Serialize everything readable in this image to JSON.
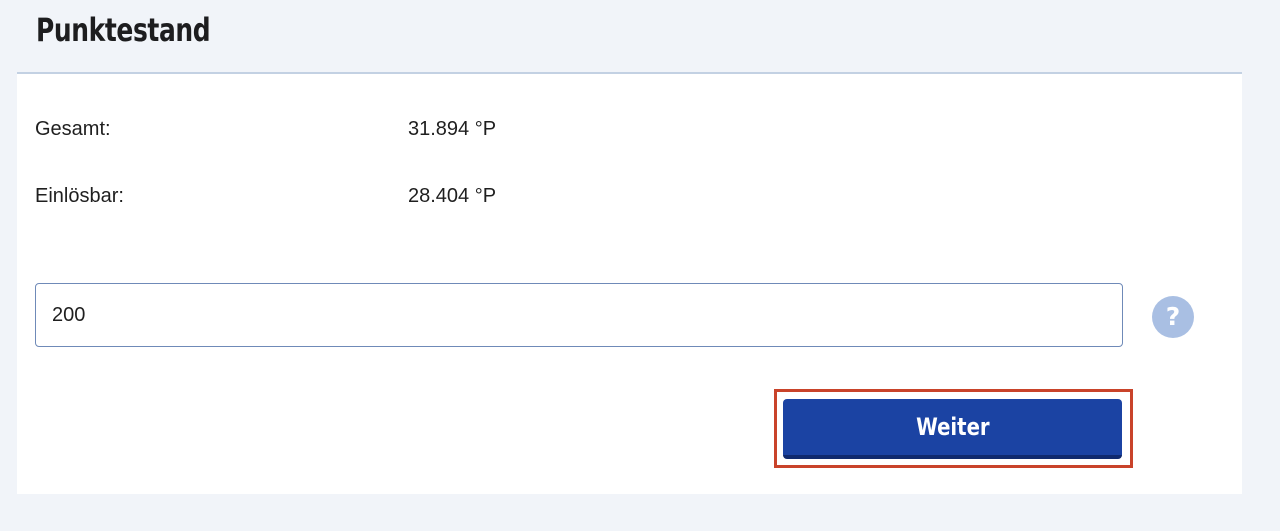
{
  "panel": {
    "title": "Punktestand"
  },
  "balance": {
    "total_label": "Gesamt:",
    "total_value": "31.894 °P",
    "redeemable_label": "Einlösbar:",
    "redeemable_value": "28.404 °P"
  },
  "points_input": {
    "value": "200"
  },
  "help": {
    "icon": "question-icon",
    "glyph": "?"
  },
  "actions": {
    "continue_label": "Weiter"
  },
  "colors": {
    "page_background": "#f1f4f9",
    "card_background": "#ffffff",
    "primary_button": "#1b43a3",
    "help_icon": "#a9bfe3",
    "highlight_frame": "#c9432a"
  }
}
